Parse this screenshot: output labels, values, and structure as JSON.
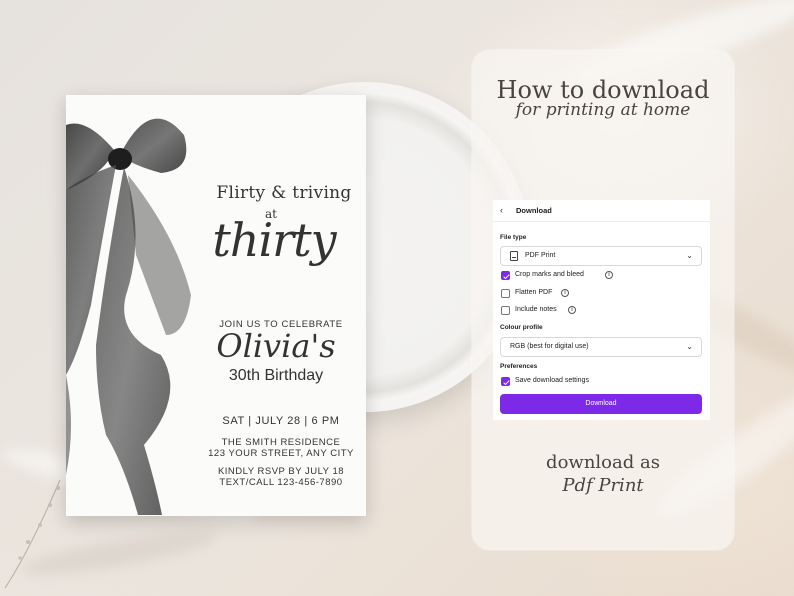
{
  "invitation": {
    "headline_line1": "Flirty & triving",
    "headline_line2": "at",
    "headline_line3": "thirty",
    "join_text": "JOIN US TO CELEBRATE",
    "name": "Olivia's",
    "occasion": "30th Birthday",
    "date_time": "SAT | JULY 28 | 6 PM",
    "venue": "THE SMITH RESIDENCE",
    "address": "123 YOUR STREET, ANY CITY",
    "rsvp": "KINDLY RSVP BY JULY 18",
    "contact": "TEXT/CALL 123-456-7890",
    "bow_icon": "black-bow-illustration"
  },
  "panel": {
    "heading": "How to download",
    "subheading": "for printing at home",
    "footer_line1": "download as",
    "footer_line2": "Pdf Print"
  },
  "download_dialog": {
    "back_icon": "chevron-left-icon",
    "title": "Download",
    "file_type_label": "File type",
    "file_type_value": "PDF Print",
    "file_type_icon": "document-icon",
    "options": [
      {
        "label": "Crop marks and bleed",
        "checked": true,
        "info": true
      },
      {
        "label": "Flatten PDF",
        "checked": false,
        "info": true
      },
      {
        "label": "Include notes",
        "checked": false,
        "info": true
      }
    ],
    "colour_profile_label": "Colour profile",
    "colour_profile_value": "RGB (best for digital use)",
    "preferences_label": "Preferences",
    "save_settings_label": "Save download settings",
    "save_settings_checked": true,
    "download_button": "Download",
    "accent_color": "#7d2ae8"
  }
}
